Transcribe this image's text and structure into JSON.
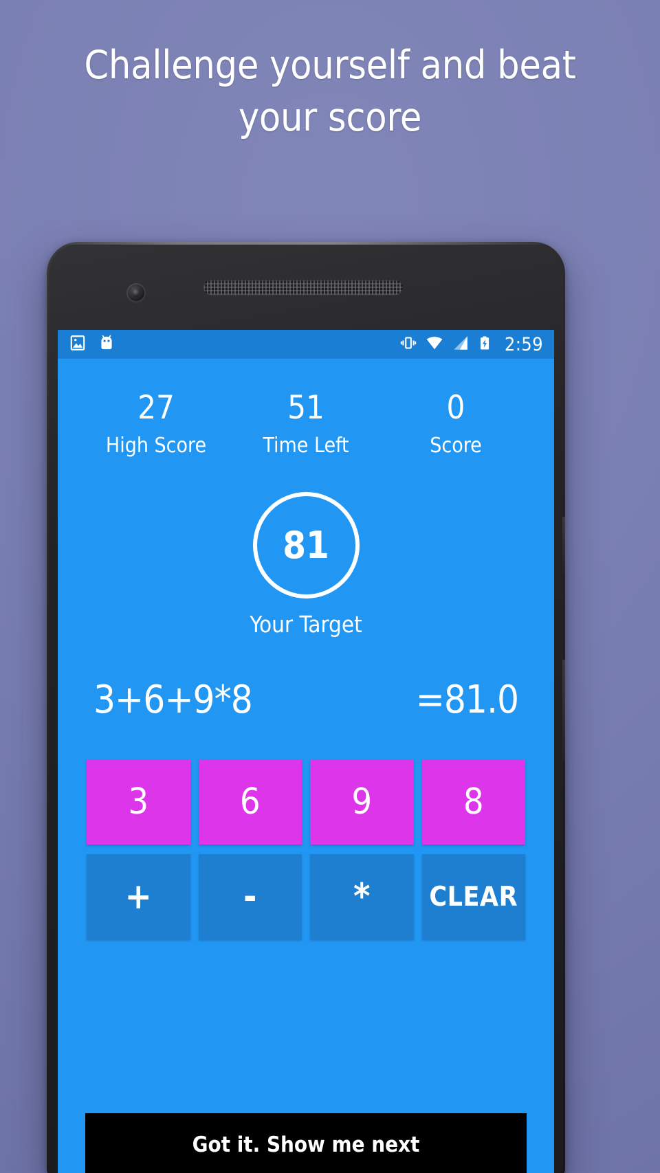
{
  "headline": "Challenge yourself and beat your score",
  "statusbar": {
    "clock": "2:59",
    "left_icons": [
      "photo-icon",
      "android-head-icon"
    ],
    "right_icons": [
      "vibrate-icon",
      "wifi-icon",
      "cellular-signal-icon",
      "battery-charging-icon"
    ]
  },
  "app": {
    "stats": [
      {
        "value": "27",
        "label": "High Score"
      },
      {
        "value": "51",
        "label": "Time Left"
      },
      {
        "value": "0",
        "label": "Score"
      }
    ],
    "target": {
      "number": "81",
      "label": "Your Target"
    },
    "equation": {
      "expression": "3+6+9*8",
      "result": "=81.0"
    },
    "keypad": {
      "numbers": [
        "3",
        "6",
        "9",
        "8"
      ],
      "operators": [
        "+",
        "-",
        "*",
        "CLEAR"
      ]
    },
    "tooltip": {
      "text": "Got it. Show me next"
    }
  },
  "colors": {
    "background": "#7b80b4",
    "app_blue": "#2196f3",
    "statusbar_blue": "#1a7fd4",
    "number_key": "#dd36ea",
    "operator_key": "#1e7ed0",
    "tooltip_bg": "#000000",
    "text_white": "#ffffff"
  }
}
